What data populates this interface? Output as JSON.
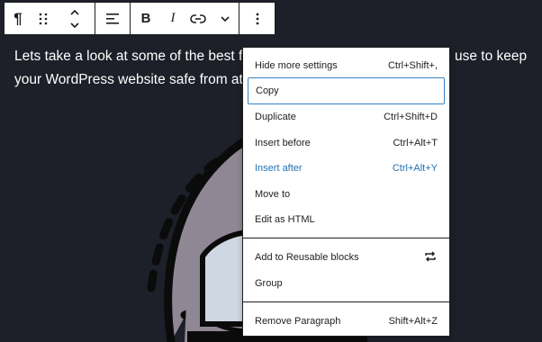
{
  "toolbar": {
    "paragraph_icon": "¶",
    "buttons": [
      "paragraph-icon",
      "drag-handle-icon",
      "move-up-down-icon",
      "align-icon",
      "bold",
      "italic",
      "link-icon",
      "chevron-down-icon",
      "more-options-icon"
    ],
    "bold_label": "B",
    "italic_label": "I"
  },
  "paragraph": {
    "line1_start": "Lets take a look at some of the best free",
    "line1_end": "use to keep",
    "line2": "your WordPress website safe from attack"
  },
  "menu": {
    "items": [
      {
        "label": "Hide more settings",
        "shortcut": "Ctrl+Shift+,"
      },
      {
        "label": "Copy",
        "shortcut": ""
      },
      {
        "label": "Duplicate",
        "shortcut": "Ctrl+Shift+D"
      },
      {
        "label": "Insert before",
        "shortcut": "Ctrl+Alt+T"
      },
      {
        "label": "Insert after",
        "shortcut": "Ctrl+Alt+Y"
      },
      {
        "label": "Move to",
        "shortcut": ""
      },
      {
        "label": "Edit as HTML",
        "shortcut": ""
      },
      {
        "label": "Add to Reusable blocks",
        "shortcut": ""
      },
      {
        "label": "Group",
        "shortcut": ""
      },
      {
        "label": "Remove Paragraph",
        "shortcut": "Shift+Alt+Z"
      }
    ],
    "reusable_icon": "repeat-icon"
  },
  "colors": {
    "background": "#1d2029",
    "accent": "#2271b1",
    "focus": "#3582c4"
  }
}
